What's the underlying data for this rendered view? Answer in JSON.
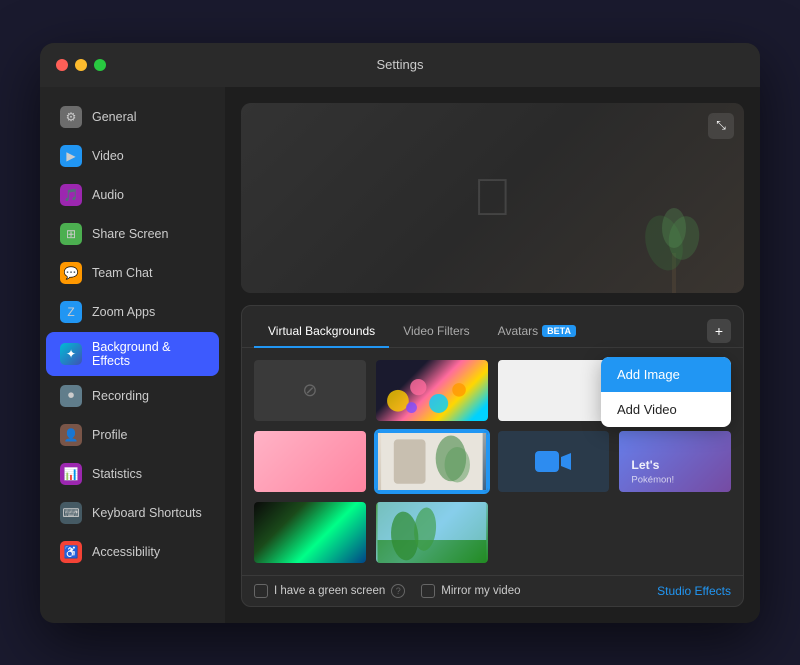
{
  "window": {
    "title": "Settings"
  },
  "sidebar": {
    "items": [
      {
        "id": "general",
        "label": "General",
        "icon": "⚙",
        "iconClass": "icon-general",
        "active": false
      },
      {
        "id": "video",
        "label": "Video",
        "icon": "▶",
        "iconClass": "icon-video",
        "active": false
      },
      {
        "id": "audio",
        "label": "Audio",
        "icon": "🎵",
        "iconClass": "icon-audio",
        "active": false
      },
      {
        "id": "share-screen",
        "label": "Share Screen",
        "icon": "⊞",
        "iconClass": "icon-share",
        "active": false
      },
      {
        "id": "team-chat",
        "label": "Team Chat",
        "icon": "💬",
        "iconClass": "icon-teamchat",
        "active": false
      },
      {
        "id": "zoom-apps",
        "label": "Zoom Apps",
        "icon": "Z",
        "iconClass": "icon-zoom",
        "active": false
      },
      {
        "id": "background",
        "label": "Background & Effects",
        "icon": "✦",
        "iconClass": "icon-bg",
        "active": true
      },
      {
        "id": "recording",
        "label": "Recording",
        "icon": "⏺",
        "iconClass": "icon-recording",
        "active": false
      },
      {
        "id": "profile",
        "label": "Profile",
        "icon": "👤",
        "iconClass": "icon-profile",
        "active": false
      },
      {
        "id": "statistics",
        "label": "Statistics",
        "icon": "📊",
        "iconClass": "icon-stats",
        "active": false
      },
      {
        "id": "keyboard",
        "label": "Keyboard Shortcuts",
        "icon": "⌨",
        "iconClass": "icon-keyboard",
        "active": false
      },
      {
        "id": "accessibility",
        "label": "Accessibility",
        "icon": "♿",
        "iconClass": "icon-access",
        "active": false
      }
    ]
  },
  "tabs": [
    {
      "id": "virtual-backgrounds",
      "label": "Virtual Backgrounds",
      "active": true
    },
    {
      "id": "video-filters",
      "label": "Video Filters",
      "active": false
    },
    {
      "id": "avatars",
      "label": "Avatars",
      "active": false,
      "badge": "BETA"
    }
  ],
  "dropdown": {
    "items": [
      {
        "id": "add-image",
        "label": "Add Image"
      },
      {
        "id": "add-video",
        "label": "Add Video"
      }
    ]
  },
  "bottom_bar": {
    "green_screen_label": "I have a green screen",
    "mirror_label": "Mirror my video",
    "studio_effects_label": "Studio Effects"
  },
  "add_button_label": "+",
  "expand_button_label": "⤡"
}
